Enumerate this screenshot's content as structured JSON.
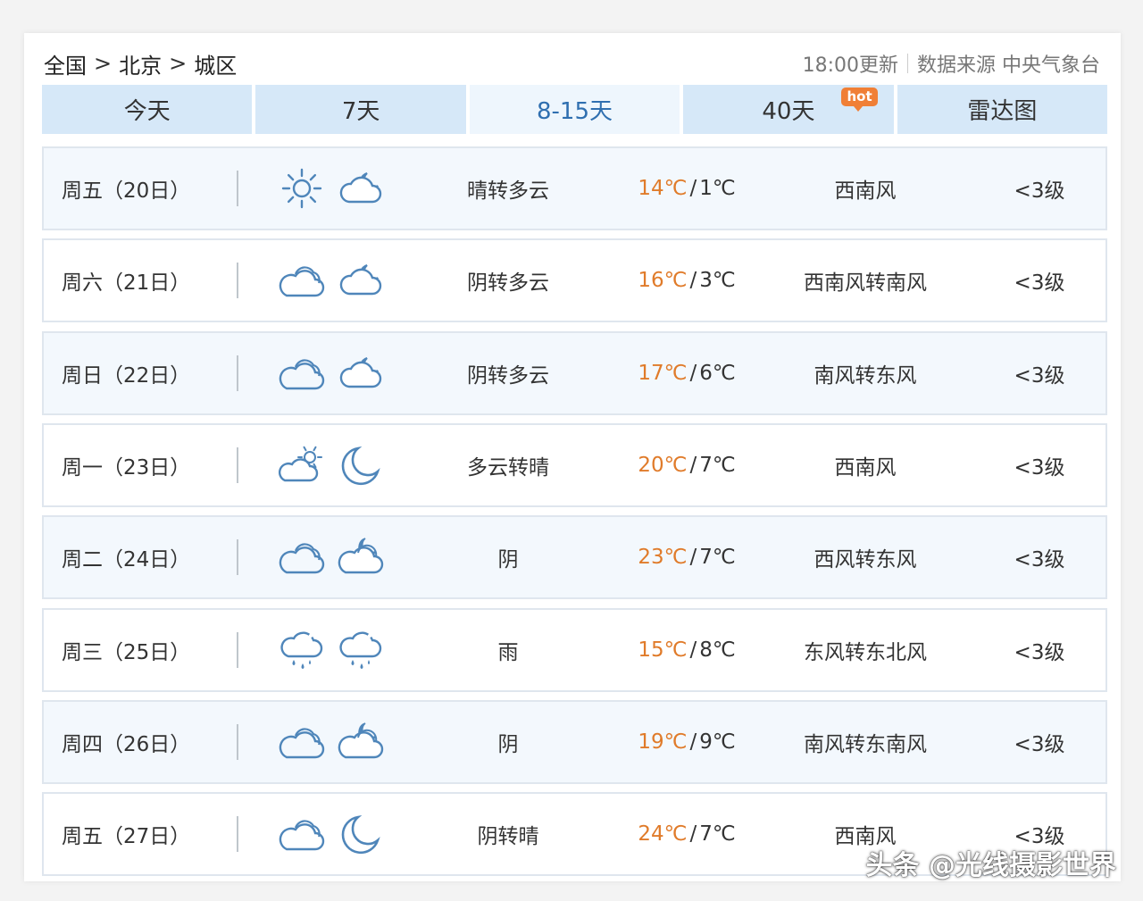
{
  "breadcrumb": {
    "level1": "全国",
    "level2": "北京",
    "level3": "城区",
    "sep": ">"
  },
  "source": {
    "update_time": "18:00更新",
    "label": "数据来源 中央气象台"
  },
  "tabs": [
    {
      "label": "今天"
    },
    {
      "label": "7天"
    },
    {
      "label": "8-15天",
      "active": true
    },
    {
      "label": "40天",
      "badge": "hot"
    },
    {
      "label": "雷达图"
    }
  ],
  "days": [
    {
      "date": "周五（20日）",
      "icon_day": "sun-icon",
      "icon_night": "cloud-moon-icon",
      "desc": "晴转多云",
      "high": "14℃",
      "low": "1℃",
      "wind": "西南风",
      "level": "<3级"
    },
    {
      "date": "周六（21日）",
      "icon_day": "cloud-icon",
      "icon_night": "cloud-moon-icon",
      "desc": "阴转多云",
      "high": "16℃",
      "low": "3℃",
      "wind": "西南风转南风",
      "level": "<3级"
    },
    {
      "date": "周日（22日）",
      "icon_day": "cloud-icon",
      "icon_night": "cloud-moon-icon",
      "desc": "阴转多云",
      "high": "17℃",
      "low": "6℃",
      "wind": "南风转东风",
      "level": "<3级"
    },
    {
      "date": "周一（23日）",
      "icon_day": "cloud-sun-icon",
      "icon_night": "moon-icon",
      "desc": "多云转晴",
      "high": "20℃",
      "low": "7℃",
      "wind": "西南风",
      "level": "<3级"
    },
    {
      "date": "周二（24日）",
      "icon_day": "cloud-icon",
      "icon_night": "cloud-night-icon",
      "desc": "阴",
      "high": "23℃",
      "low": "7℃",
      "wind": "西风转东风",
      "level": "<3级"
    },
    {
      "date": "周三（25日）",
      "icon_day": "rain-icon",
      "icon_night": "rain-icon",
      "desc": "雨",
      "high": "15℃",
      "low": "8℃",
      "wind": "东风转东北风",
      "level": "<3级"
    },
    {
      "date": "周四（26日）",
      "icon_day": "cloud-icon",
      "icon_night": "cloud-night-icon",
      "desc": "阴",
      "high": "19℃",
      "low": "9℃",
      "wind": "南风转东南风",
      "level": "<3级"
    },
    {
      "date": "周五（27日）",
      "icon_day": "cloud-icon",
      "icon_night": "moon-icon",
      "desc": "阴转晴",
      "high": "24℃",
      "low": "7℃",
      "wind": "西南风",
      "level": "<3级"
    }
  ],
  "watermark": "头条 @光线摄影世界",
  "colors": {
    "accent": "#2f6fb0",
    "tab_bg": "#d6e8f8",
    "high_temp": "#e07b2a",
    "icon": "#4f86ba"
  }
}
